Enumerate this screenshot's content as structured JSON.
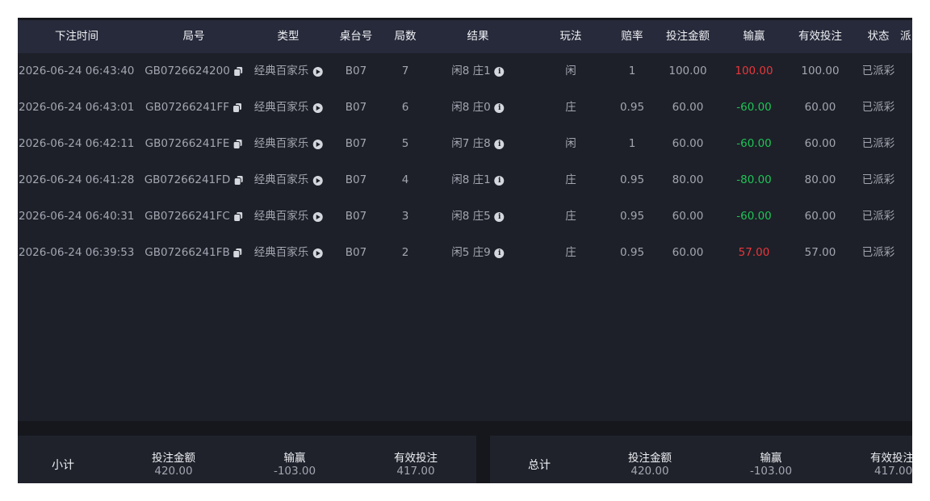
{
  "table": {
    "columns": [
      "下注时间",
      "局号",
      "类型",
      "桌台号",
      "局数",
      "结果",
      "玩法",
      "赔率",
      "投注金额",
      "输赢",
      "有效投注",
      "状态",
      "派"
    ],
    "rows": [
      {
        "time": "2026-06-24 06:43:40",
        "round_id": "GB0726624200",
        "type": "经典百家乐",
        "table": "B07",
        "round": "7",
        "result": "闲8 庄1",
        "play": "闲",
        "odds": "1",
        "bet": "100.00",
        "win_loss": "100.00",
        "win_sign": "pos",
        "valid_bet": "100.00",
        "status": "已派彩"
      },
      {
        "time": "2026-06-24 06:43:01",
        "round_id": "GB07266241FF",
        "type": "经典百家乐",
        "table": "B07",
        "round": "6",
        "result": "闲8 庄0",
        "play": "庄",
        "odds": "0.95",
        "bet": "60.00",
        "win_loss": "-60.00",
        "win_sign": "neg",
        "valid_bet": "60.00",
        "status": "已派彩"
      },
      {
        "time": "2026-06-24 06:42:11",
        "round_id": "GB07266241FE",
        "type": "经典百家乐",
        "table": "B07",
        "round": "5",
        "result": "闲7 庄8",
        "play": "闲",
        "odds": "1",
        "bet": "60.00",
        "win_loss": "-60.00",
        "win_sign": "neg",
        "valid_bet": "60.00",
        "status": "已派彩"
      },
      {
        "time": "2026-06-24 06:41:28",
        "round_id": "GB07266241FD",
        "type": "经典百家乐",
        "table": "B07",
        "round": "4",
        "result": "闲8 庄1",
        "play": "庄",
        "odds": "0.95",
        "bet": "80.00",
        "win_loss": "-80.00",
        "win_sign": "neg",
        "valid_bet": "80.00",
        "status": "已派彩"
      },
      {
        "time": "2026-06-24 06:40:31",
        "round_id": "GB07266241FC",
        "type": "经典百家乐",
        "table": "B07",
        "round": "3",
        "result": "闲8 庄5",
        "play": "庄",
        "odds": "0.95",
        "bet": "60.00",
        "win_loss": "-60.00",
        "win_sign": "neg",
        "valid_bet": "60.00",
        "status": "已派彩"
      },
      {
        "time": "2026-06-24 06:39:53",
        "round_id": "GB07266241FB",
        "type": "经典百家乐",
        "table": "B07",
        "round": "2",
        "result": "闲5 庄9",
        "play": "庄",
        "odds": "0.95",
        "bet": "60.00",
        "win_loss": "57.00",
        "win_sign": "pos",
        "valid_bet": "57.00",
        "status": "已派彩"
      }
    ]
  },
  "icons": {
    "round_id": "copy-icon",
    "type": "play-icon",
    "result": "info-icon"
  },
  "colors": {
    "positive": "#e8373c",
    "negative": "#1fc457"
  },
  "subtotal": {
    "label": "小计",
    "bet_label": "投注金额",
    "bet": "420.00",
    "win_loss_label": "输赢",
    "win_loss": "-103.00",
    "valid_label": "有效投注",
    "valid": "417.00"
  },
  "total": {
    "label": "总计",
    "bet_label": "投注金额",
    "bet": "420.00",
    "win_loss_label": "输赢",
    "win_loss": "-103.00",
    "valid_label": "有效投注",
    "valid": "417.00"
  }
}
